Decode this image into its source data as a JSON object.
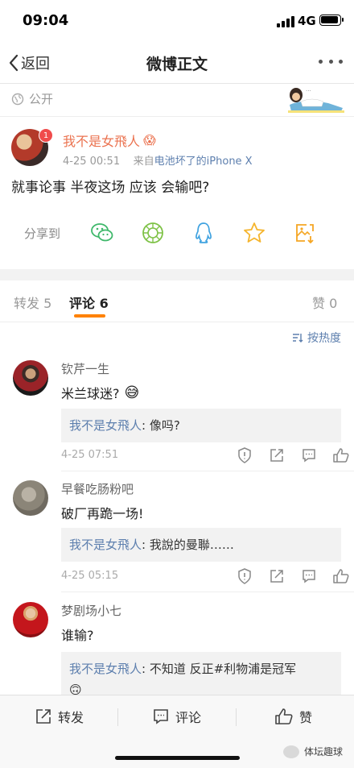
{
  "status_bar": {
    "time": "09:04",
    "network": "4G"
  },
  "nav": {
    "back_label": "返回",
    "title": "微博正文"
  },
  "visibility": {
    "label": "公开"
  },
  "post": {
    "username": "我不是女飛人",
    "emoji": "😱",
    "badge": "1",
    "timestamp": "4-25 00:51",
    "source_prefix": "来自",
    "source": "电池坏了的iPhone X",
    "text": "就事论事 半夜这场 应该 会输吧?",
    "share_label": "分享到"
  },
  "tabs": [
    {
      "label": "转发 5"
    },
    {
      "label": "评论 6"
    },
    {
      "label": "赞 0"
    }
  ],
  "sort_label": "按热度",
  "comments": [
    {
      "user": "钦芹一生",
      "text": "米兰球迷?",
      "emoji": "😅",
      "reply_user": "我不是女飛人",
      "reply_text": ": 像吗?",
      "time": "4-25 07:51"
    },
    {
      "user": "早餐吃肠粉吧",
      "text": "破厂再跪一场!",
      "emoji": "",
      "reply_user": "我不是女飛人",
      "reply_text": ": 我說的曼聯……",
      "time": "4-25 05:15"
    },
    {
      "user": "梦剧场小七",
      "text": "谁输?",
      "emoji": "",
      "reply_user": "我不是女飛人",
      "reply_text": ": 不知道 反正#利物浦是冠军",
      "reply_emoji": "🙃"
    }
  ],
  "bottom_bar": {
    "repost": "转发",
    "comment": "评论",
    "like": "赞"
  },
  "watermark": "体坛趣球",
  "colors": {
    "accent": "#ff8200",
    "username_orange": "#eb7350",
    "link_blue": "#5d7fae"
  }
}
